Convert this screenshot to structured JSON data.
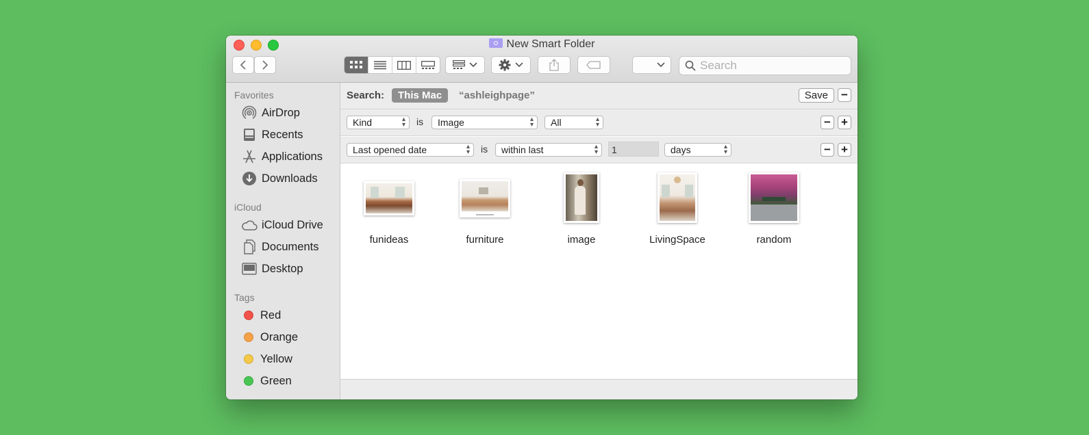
{
  "window": {
    "title": "New Smart Folder"
  },
  "search": {
    "placeholder": "Search"
  },
  "sidebar": {
    "favorites_header": "Favorites",
    "favorites": [
      "AirDrop",
      "Recents",
      "Applications",
      "Downloads"
    ],
    "icloud_header": "iCloud",
    "icloud": [
      "iCloud Drive",
      "Documents",
      "Desktop"
    ],
    "tags_header": "Tags",
    "tags": [
      {
        "label": "Red",
        "color": "#f0524a"
      },
      {
        "label": "Orange",
        "color": "#f5a14a"
      },
      {
        "label": "Yellow",
        "color": "#f4c94a"
      },
      {
        "label": "Green",
        "color": "#48c653"
      }
    ]
  },
  "scope": {
    "label": "Search:",
    "this_mac": "This Mac",
    "query": "“ashleighpage”",
    "save": "Save"
  },
  "rules": {
    "row1": {
      "attribute": "Kind",
      "operator": "is",
      "value": "Image",
      "option": "All"
    },
    "row2": {
      "attribute": "Last opened date",
      "operator": "is",
      "value": "within last",
      "amount": "1",
      "unit": "days"
    }
  },
  "files": [
    {
      "name": "funideas"
    },
    {
      "name": "furniture"
    },
    {
      "name": "image"
    },
    {
      "name": "LivingSpace"
    },
    {
      "name": "random"
    }
  ],
  "colors": {
    "background": "#5dbd5f",
    "selected_segment": "#6d6d6d",
    "scope_pill": "#8f8f8f"
  }
}
